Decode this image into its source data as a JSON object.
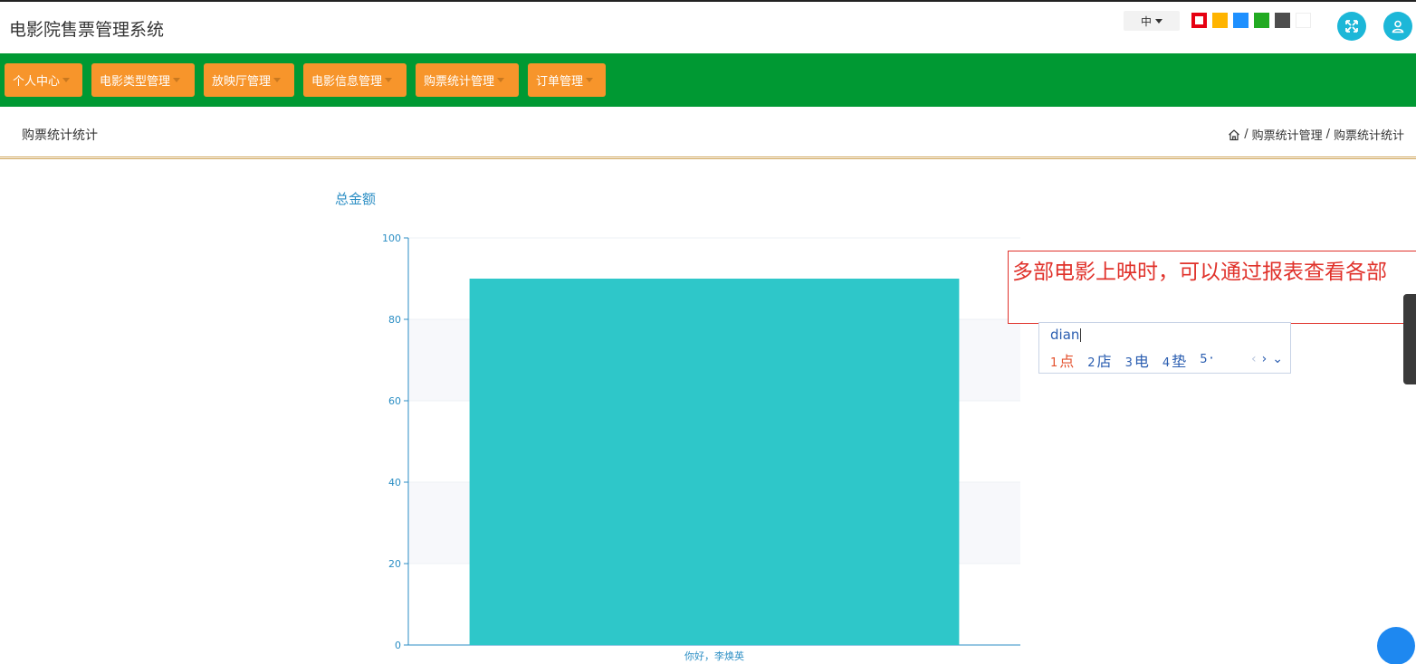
{
  "header": {
    "title": "电影院售票管理系统",
    "lang": "中",
    "theme_colors": [
      "#e60012",
      "#ffb400",
      "#1e90ff",
      "#22aa22",
      "#4d4d4d",
      "#ffffff"
    ],
    "fullscreen_icon": "expand-icon",
    "user_icon": "user-icon"
  },
  "nav": {
    "items": [
      {
        "label": "个人中心"
      },
      {
        "label": "电影类型管理"
      },
      {
        "label": "放映厅管理"
      },
      {
        "label": "电影信息管理"
      },
      {
        "label": "购票统计管理"
      },
      {
        "label": "订单管理"
      }
    ]
  },
  "page": {
    "title": "购票统计统计",
    "breadcrumb": {
      "home_icon": "home-icon",
      "separator": "/",
      "items": [
        "购票统计管理",
        "购票统计统计"
      ]
    }
  },
  "chart_data": {
    "type": "bar",
    "title": "总金额",
    "categories": [
      "你好，李焕英"
    ],
    "values": [
      90
    ],
    "ylim": [
      0,
      100
    ],
    "yticks": [
      0,
      20,
      40,
      60,
      80,
      100
    ],
    "grid": true,
    "bar_color": "#2ec7c9",
    "axis_color": "#2b8ec4"
  },
  "overlay": {
    "text": "多部电影上映时，可以通过报表查看各部",
    "ime_input": "dian",
    "candidates": [
      {
        "num": "1",
        "char": "点"
      },
      {
        "num": "2",
        "char": "店"
      },
      {
        "num": "3",
        "char": "电"
      },
      {
        "num": "4",
        "char": "垫"
      },
      {
        "num": "5",
        "char": "·"
      }
    ],
    "prev": "‹",
    "next": "›",
    "more": "⌄"
  }
}
